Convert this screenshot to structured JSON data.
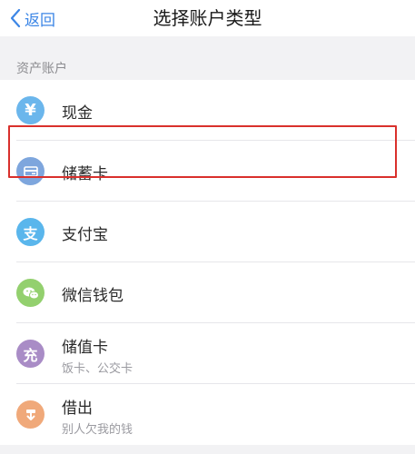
{
  "nav": {
    "back_label": "返回",
    "title": "选择账户类型"
  },
  "section": {
    "title": "资产账户"
  },
  "accounts": [
    {
      "label": "现金",
      "icon": "yuan-icon",
      "color": "#6bb6ec"
    },
    {
      "label": "储蓄卡",
      "icon": "bank-card-icon",
      "color": "#7ea6dd"
    },
    {
      "label": "支付宝",
      "icon": "alipay-icon",
      "color": "#5ab6ec"
    },
    {
      "label": "微信钱包",
      "icon": "wechat-icon",
      "color": "#93d06e"
    },
    {
      "label": "储值卡",
      "sublabel": "饭卡、公交卡",
      "icon": "stored-value-card-icon",
      "color": "#a98cc6"
    },
    {
      "label": "借出",
      "sublabel": "别人欠我的钱",
      "icon": "lend-out-icon",
      "color": "#f0a97a"
    }
  ],
  "icon_glyphs": {
    "yuan": "¥",
    "alipay": "支",
    "stored_value": "充"
  }
}
